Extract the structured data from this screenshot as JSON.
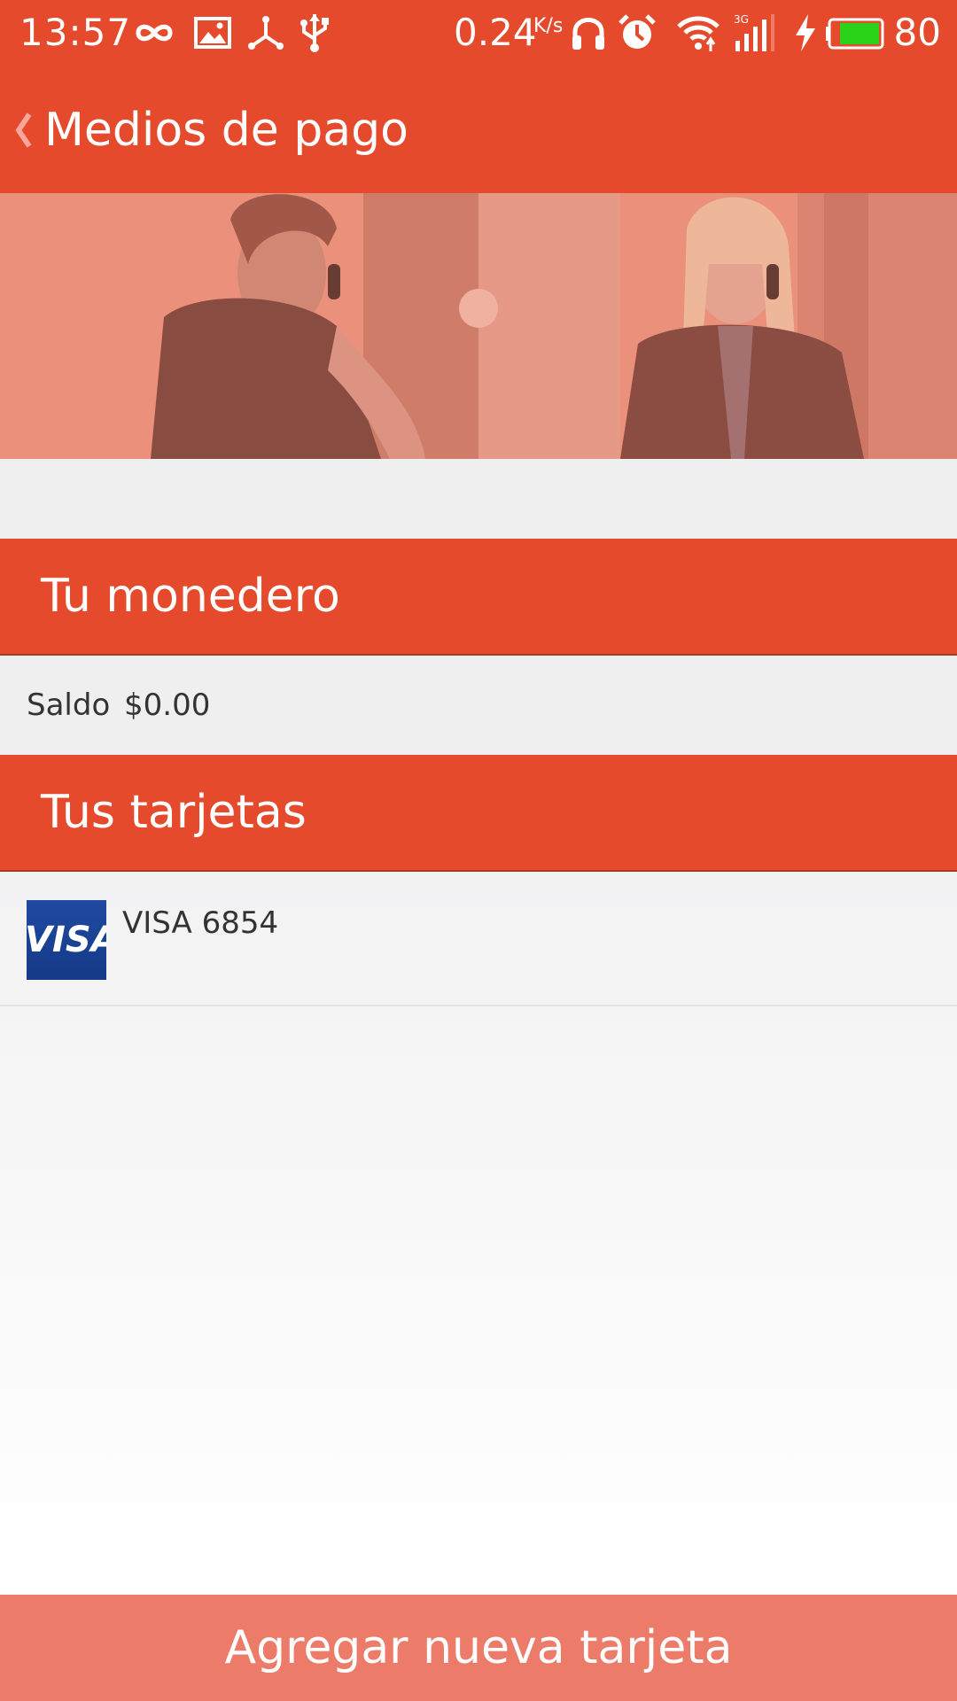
{
  "status_bar": {
    "time": "13:57",
    "speed": "0.24",
    "speed_unit": "K/s",
    "battery_percent": "80",
    "icons": [
      "infinity-icon",
      "image-icon",
      "share-node-icon",
      "usb-icon",
      "headphones-icon",
      "alarm-icon",
      "wifi-icon",
      "signal-3g-icon",
      "charging-icon",
      "battery-icon"
    ]
  },
  "app_bar": {
    "title": "Medios de pago",
    "back_icon": "chevron-left-icon"
  },
  "banner": {
    "description_icon": "people-on-phone-banner"
  },
  "wallet": {
    "title": "Tu monedero",
    "balance_label": "Saldo",
    "balance_value": "$0.00"
  },
  "cards": {
    "title": "Tus tarjetas",
    "items": [
      {
        "brand": "VISA",
        "label": "VISA 6854"
      }
    ]
  },
  "actions": {
    "add_card_label": "Agregar nueva tarjeta"
  },
  "colors": {
    "primary": "#e44a2b",
    "button": "#ec7b69",
    "visa_blue": "#1a3f8f"
  }
}
